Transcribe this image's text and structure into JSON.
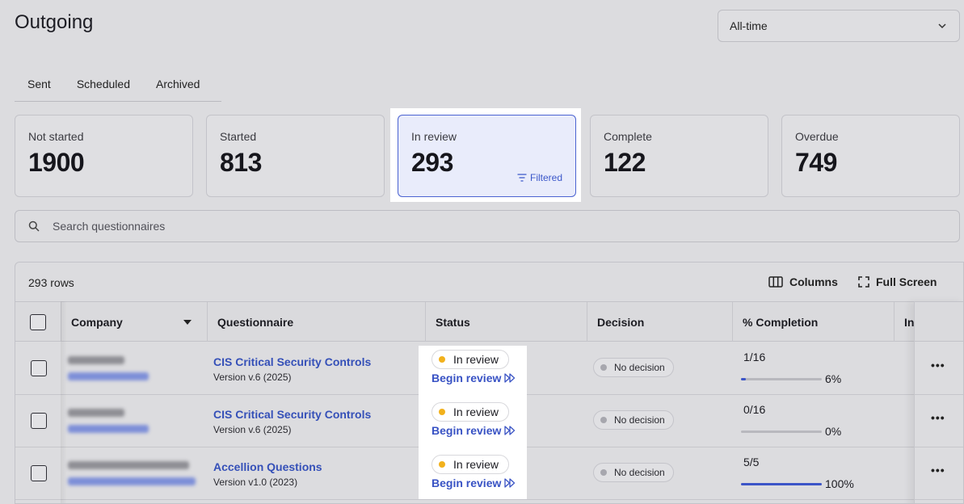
{
  "page": {
    "title": "Outgoing"
  },
  "range_select": {
    "value": "All-time",
    "icon": "chevron-down-icon"
  },
  "tabs": [
    {
      "label": "Sent"
    },
    {
      "label": "Scheduled"
    },
    {
      "label": "Archived"
    }
  ],
  "stats": [
    {
      "label": "Not started",
      "value": "1900"
    },
    {
      "label": "Started",
      "value": "813"
    },
    {
      "label": "In review",
      "value": "293",
      "filter_label": "Filtered"
    },
    {
      "label": "Complete",
      "value": "122"
    },
    {
      "label": "Overdue",
      "value": "749"
    }
  ],
  "search": {
    "placeholder": "Search questionnaires"
  },
  "table": {
    "row_count": "293 rows",
    "columns_label": "Columns",
    "fullscreen_label": "Full Screen",
    "headers": {
      "company": "Company",
      "questionnaire": "Questionnaire",
      "status": "Status",
      "decision": "Decision",
      "completion": "% Completion",
      "next": "In"
    },
    "rows": [
      {
        "questionnaire": "CIS Critical Security Controls",
        "version": "Version v.6 (2025)",
        "status": "In review",
        "action": "Begin review",
        "decision": "No decision",
        "fraction": "1/16",
        "percent_label": "6%",
        "percent": 6
      },
      {
        "questionnaire": "CIS Critical Security Controls",
        "version": "Version v.6 (2025)",
        "status": "In review",
        "action": "Begin review",
        "decision": "No decision",
        "fraction": "0/16",
        "percent_label": "0%",
        "percent": 0
      },
      {
        "questionnaire": "Accellion Questions",
        "version": "Version v1.0 (2023)",
        "status": "In review",
        "action": "Begin review",
        "decision": "No decision",
        "fraction": "5/5",
        "percent_label": "100%",
        "percent": 100
      }
    ]
  },
  "colors": {
    "accent": "#3c55c8",
    "status_dot": "#f2b11c",
    "active_card_bg": "#e9ecfb"
  }
}
